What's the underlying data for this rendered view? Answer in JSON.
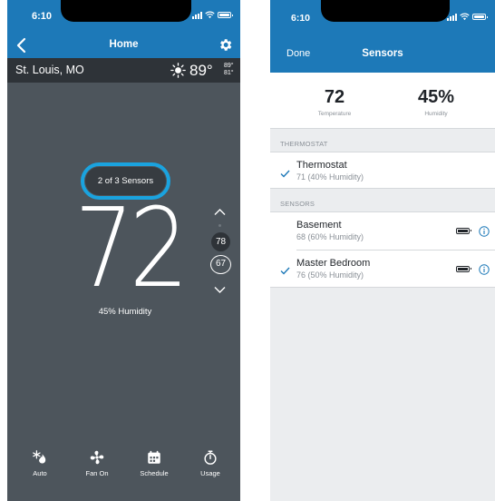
{
  "left_screen": {
    "status": {
      "time": "6:10"
    },
    "nav": {
      "title": "Home",
      "back_icon": "chevron-left-icon",
      "settings_icon": "gear-icon"
    },
    "weather": {
      "city": "St. Louis, MO",
      "icon": "sun-icon",
      "temp": "89°",
      "high": "89°",
      "low": "81°"
    },
    "sensor_pill": "2 of 3 Sensors",
    "current_temp": "72",
    "humidity": "45% Humidity",
    "setpoints": {
      "heat": "78",
      "cool": "67"
    },
    "bottom_nav": [
      {
        "label": "Auto",
        "icon": "mode-auto-icon"
      },
      {
        "label": "Fan On",
        "icon": "fan-icon"
      },
      {
        "label": "Schedule",
        "icon": "calendar-icon"
      },
      {
        "label": "Usage",
        "icon": "stopwatch-icon"
      }
    ],
    "colors": {
      "header": "#1d79b8",
      "background": "#4d555c",
      "highlight": "#1aa3df"
    }
  },
  "right_screen": {
    "status": {
      "time": "6:10"
    },
    "nav": {
      "done": "Done",
      "title": "Sensors"
    },
    "summary": {
      "temperature_value": "72",
      "temperature_label": "Temperature",
      "humidity_value": "45%",
      "humidity_label": "Humidity"
    },
    "thermostat_header": "THERMOSTAT",
    "thermostat": {
      "name": "Thermostat",
      "detail": "71 (40% Humidity)",
      "checked": true
    },
    "sensors_header": "SENSORS",
    "sensors": [
      {
        "name": "Basement",
        "detail": "68 (60% Humidity)",
        "checked": false
      },
      {
        "name": "Master Bedroom",
        "detail": "76 (50% Humidity)",
        "checked": true
      }
    ]
  }
}
